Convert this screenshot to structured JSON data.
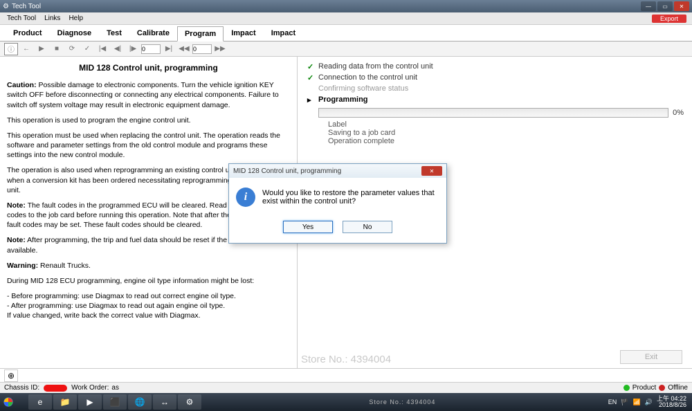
{
  "titlebar": {
    "app": "Tech Tool"
  },
  "menubar": {
    "items": [
      "Tech Tool",
      "Links",
      "Help"
    ],
    "export": "Export"
  },
  "tabs": [
    "Product",
    "Diagnose",
    "Test",
    "Calibrate",
    "Program",
    "Impact",
    "Impact"
  ],
  "active_tab": 4,
  "toolbar": {
    "page_input": "0",
    "of": "0"
  },
  "doc": {
    "title": "MID 128 Control unit, programming",
    "p1_label": "Caution:",
    "p1": " Possible damage to electronic components. Turn the vehicle ignition KEY switch OFF before disconnecting or connecting any electrical components. Failure to switch off system voltage may result in electronic equipment damage.",
    "p2": "This operation is used to program the engine control unit.",
    "p3": "This operation must be used when replacing the control unit. The operation reads the software and parameter settings from the old control module and programs these settings into the new control module.",
    "p4": "The operation is also used when reprogramming an existing control unit, for example when a conversion kit has been ordered necessitating reprogramming of the control unit.",
    "p5_label": "Note:",
    "p5": " The fault codes in the programmed ECU will be cleared. Read and save all fault codes to the job card before running this operation. Note that after the operation new fault codes may be set. These fault codes should be cleared.",
    "p6_label": "Note:",
    "p6": " After programming, the trip and fuel data should be reset if the options are available.",
    "p7_label": "Warning:",
    "p7": " Renault Trucks.",
    "p8": "During MID 128 ECU programming, engine oil type information might be lost:",
    "p9": "- Before programming: use Diagmax to read out correct engine oil type.",
    "p10": "- After programming: use Diagmax to read out again engine oil type.",
    "p11": "If value changed, write back the correct value with Diagmax."
  },
  "steps": {
    "s1": "Reading data from the control unit",
    "s2": "Connection to the control unit",
    "s3": "Confirming software status",
    "s4": "Programming",
    "pct": "0%",
    "sub1": "Label",
    "sub2": "Saving to a job card",
    "sub3": "Operation complete",
    "exit": "Exit"
  },
  "dialog": {
    "title": "MID 128 Control unit, programming",
    "msg": "Would you like to restore the parameter values that exist within the control unit?",
    "yes": "Yes",
    "no": "No"
  },
  "status": {
    "chassis_label": "Chassis ID:",
    "work_label": "Work Order:",
    "work_val": "as",
    "product": "Product",
    "offline": "Offline"
  },
  "taskbar": {
    "watermark": "Store No.: 4394004",
    "lang": "EN",
    "time": "上午 04:22",
    "date": "2018/8/26"
  }
}
